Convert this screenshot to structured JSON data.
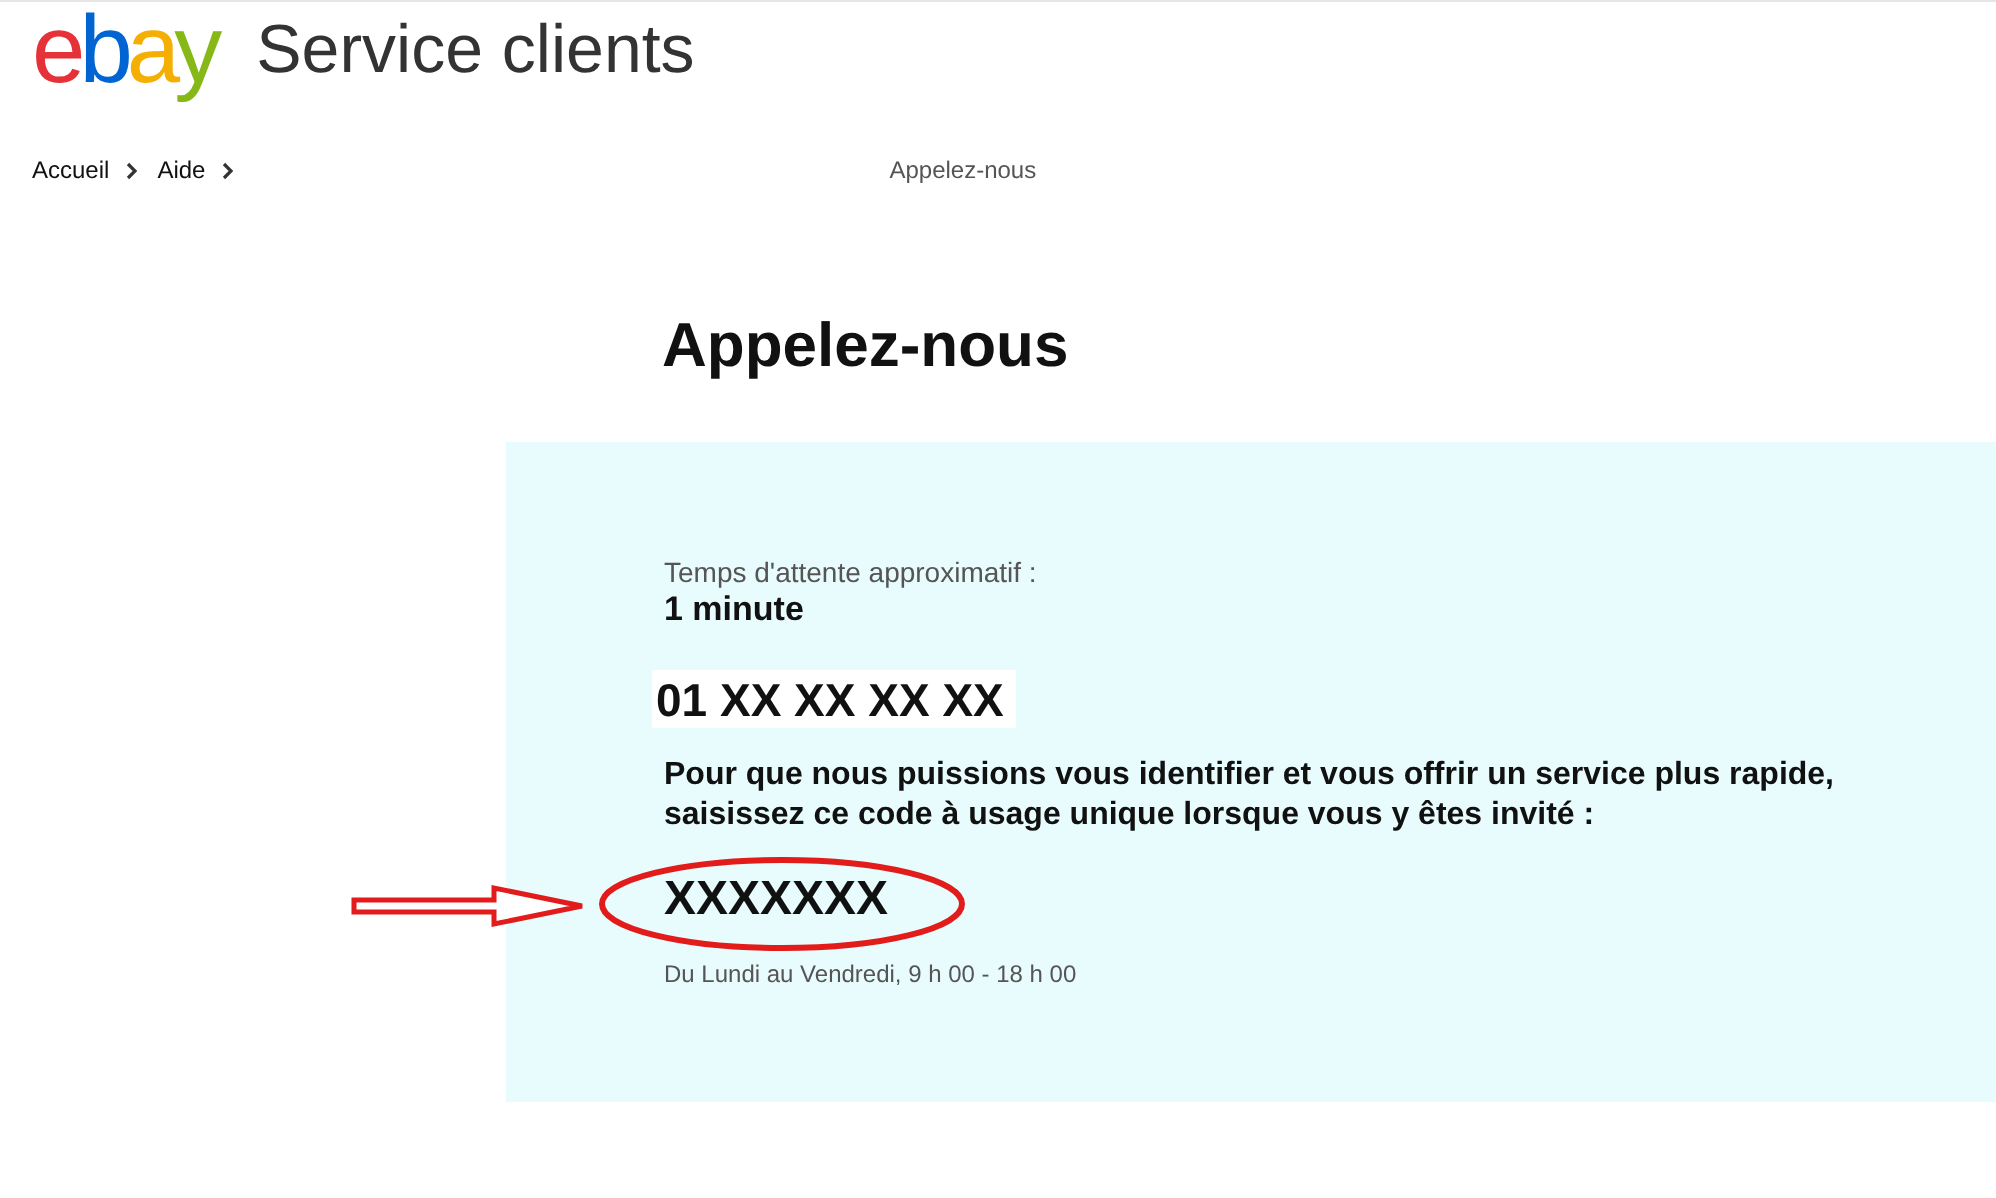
{
  "header": {
    "logo": [
      {
        "char": "e",
        "color": "#e53238"
      },
      {
        "char": "b",
        "color": "#0064d2"
      },
      {
        "char": "a",
        "color": "#f5af02"
      },
      {
        "char": "y",
        "color": "#86b817"
      }
    ],
    "title": "Service clients"
  },
  "breadcrumb": {
    "items": [
      "Accueil",
      "Aide"
    ],
    "current": "Appelez-nous"
  },
  "page_title": "Appelez-nous",
  "panel": {
    "wait_label": "Temps d'attente approximatif :",
    "wait_value": "1 minute",
    "phone": "01 XX XX XX XX",
    "instructions": "Pour que nous puissions vous identifier et vous offrir un service plus rapide, saisissez ce code à usage unique lorsque vous y êtes invité :",
    "code": "XXXXXXX",
    "hours": "Du Lundi au Vendredi, 9 h 00 - 18 h 00"
  }
}
